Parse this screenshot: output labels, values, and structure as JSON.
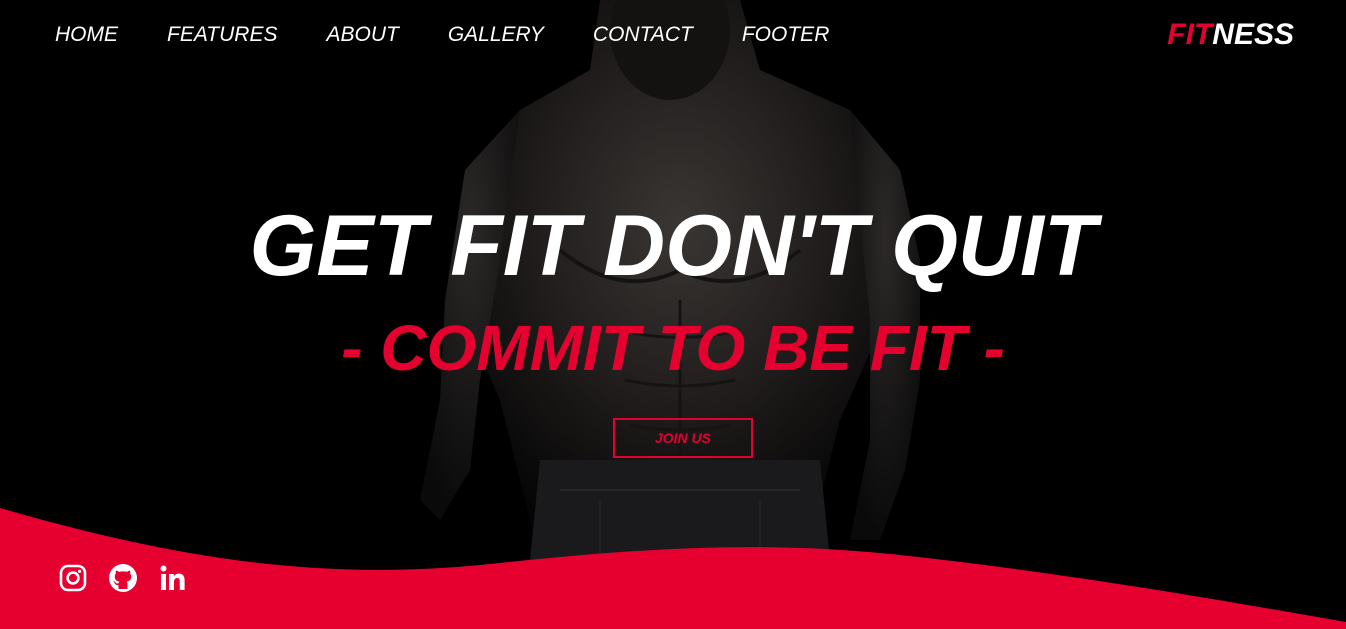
{
  "nav": {
    "items": [
      {
        "label": "HOME"
      },
      {
        "label": "FEATURES"
      },
      {
        "label": "ABOUT"
      },
      {
        "label": "GALLERY"
      },
      {
        "label": "CONTACT"
      },
      {
        "label": "FOOTER"
      }
    ]
  },
  "logo": {
    "part1": "FIT",
    "part2": "NESS"
  },
  "hero": {
    "headline": "GET FIT DON'T QUIT",
    "subline": "- COMMIT TO BE FIT -",
    "cta_label": "JOIN US"
  },
  "socials": {
    "icons": [
      "instagram-icon",
      "github-icon",
      "linkedin-icon"
    ]
  },
  "colors": {
    "accent": "#e60030",
    "background": "#000000",
    "text": "#ffffff"
  }
}
